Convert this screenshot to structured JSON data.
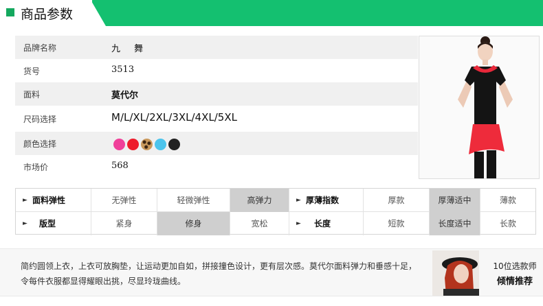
{
  "header": {
    "title": "商品参数",
    "accent": "#14c070"
  },
  "product": {
    "rows": [
      {
        "label": "品牌名称",
        "value": "九  舞"
      },
      {
        "label": "货号",
        "value": "3513"
      },
      {
        "label": "面料",
        "value": "莫代尔"
      },
      {
        "label": "尺码选择",
        "value": "M/L/XL/2XL/3XL/4XL/5XL"
      },
      {
        "label": "颜色选择",
        "value": ""
      },
      {
        "label": "市场价",
        "value": "568"
      }
    ],
    "colors": [
      "#f0409a",
      "#ee1c2c",
      "leopard",
      "#4cc4ec",
      "#222222"
    ]
  },
  "attributes": {
    "row1": {
      "head": "面料弹性",
      "options": [
        "无弹性",
        "轻微弹性",
        "高弹力"
      ],
      "selected": 2,
      "head2": "厚薄指数",
      "options2": [
        "厚款",
        "厚薄适中",
        "薄款"
      ],
      "selected2": 1
    },
    "row2": {
      "head": "版型",
      "options": [
        "紧身",
        "修身",
        "宽松"
      ],
      "selected": 1,
      "head2": "长度",
      "options2": [
        "短款",
        "长度适中",
        "长款"
      ],
      "selected2": 1
    }
  },
  "footer": {
    "description": "简约圆领上衣，上衣可放胸垫，让运动更加自如，拼接撞色设计，更有层次感。莫代尔面料弹力和垂感十足，令每件衣服都显得耀眼出挑，尽显玲珑曲线。",
    "recommend_line1": "10位选款师",
    "recommend_line2": "倾情推荐"
  }
}
